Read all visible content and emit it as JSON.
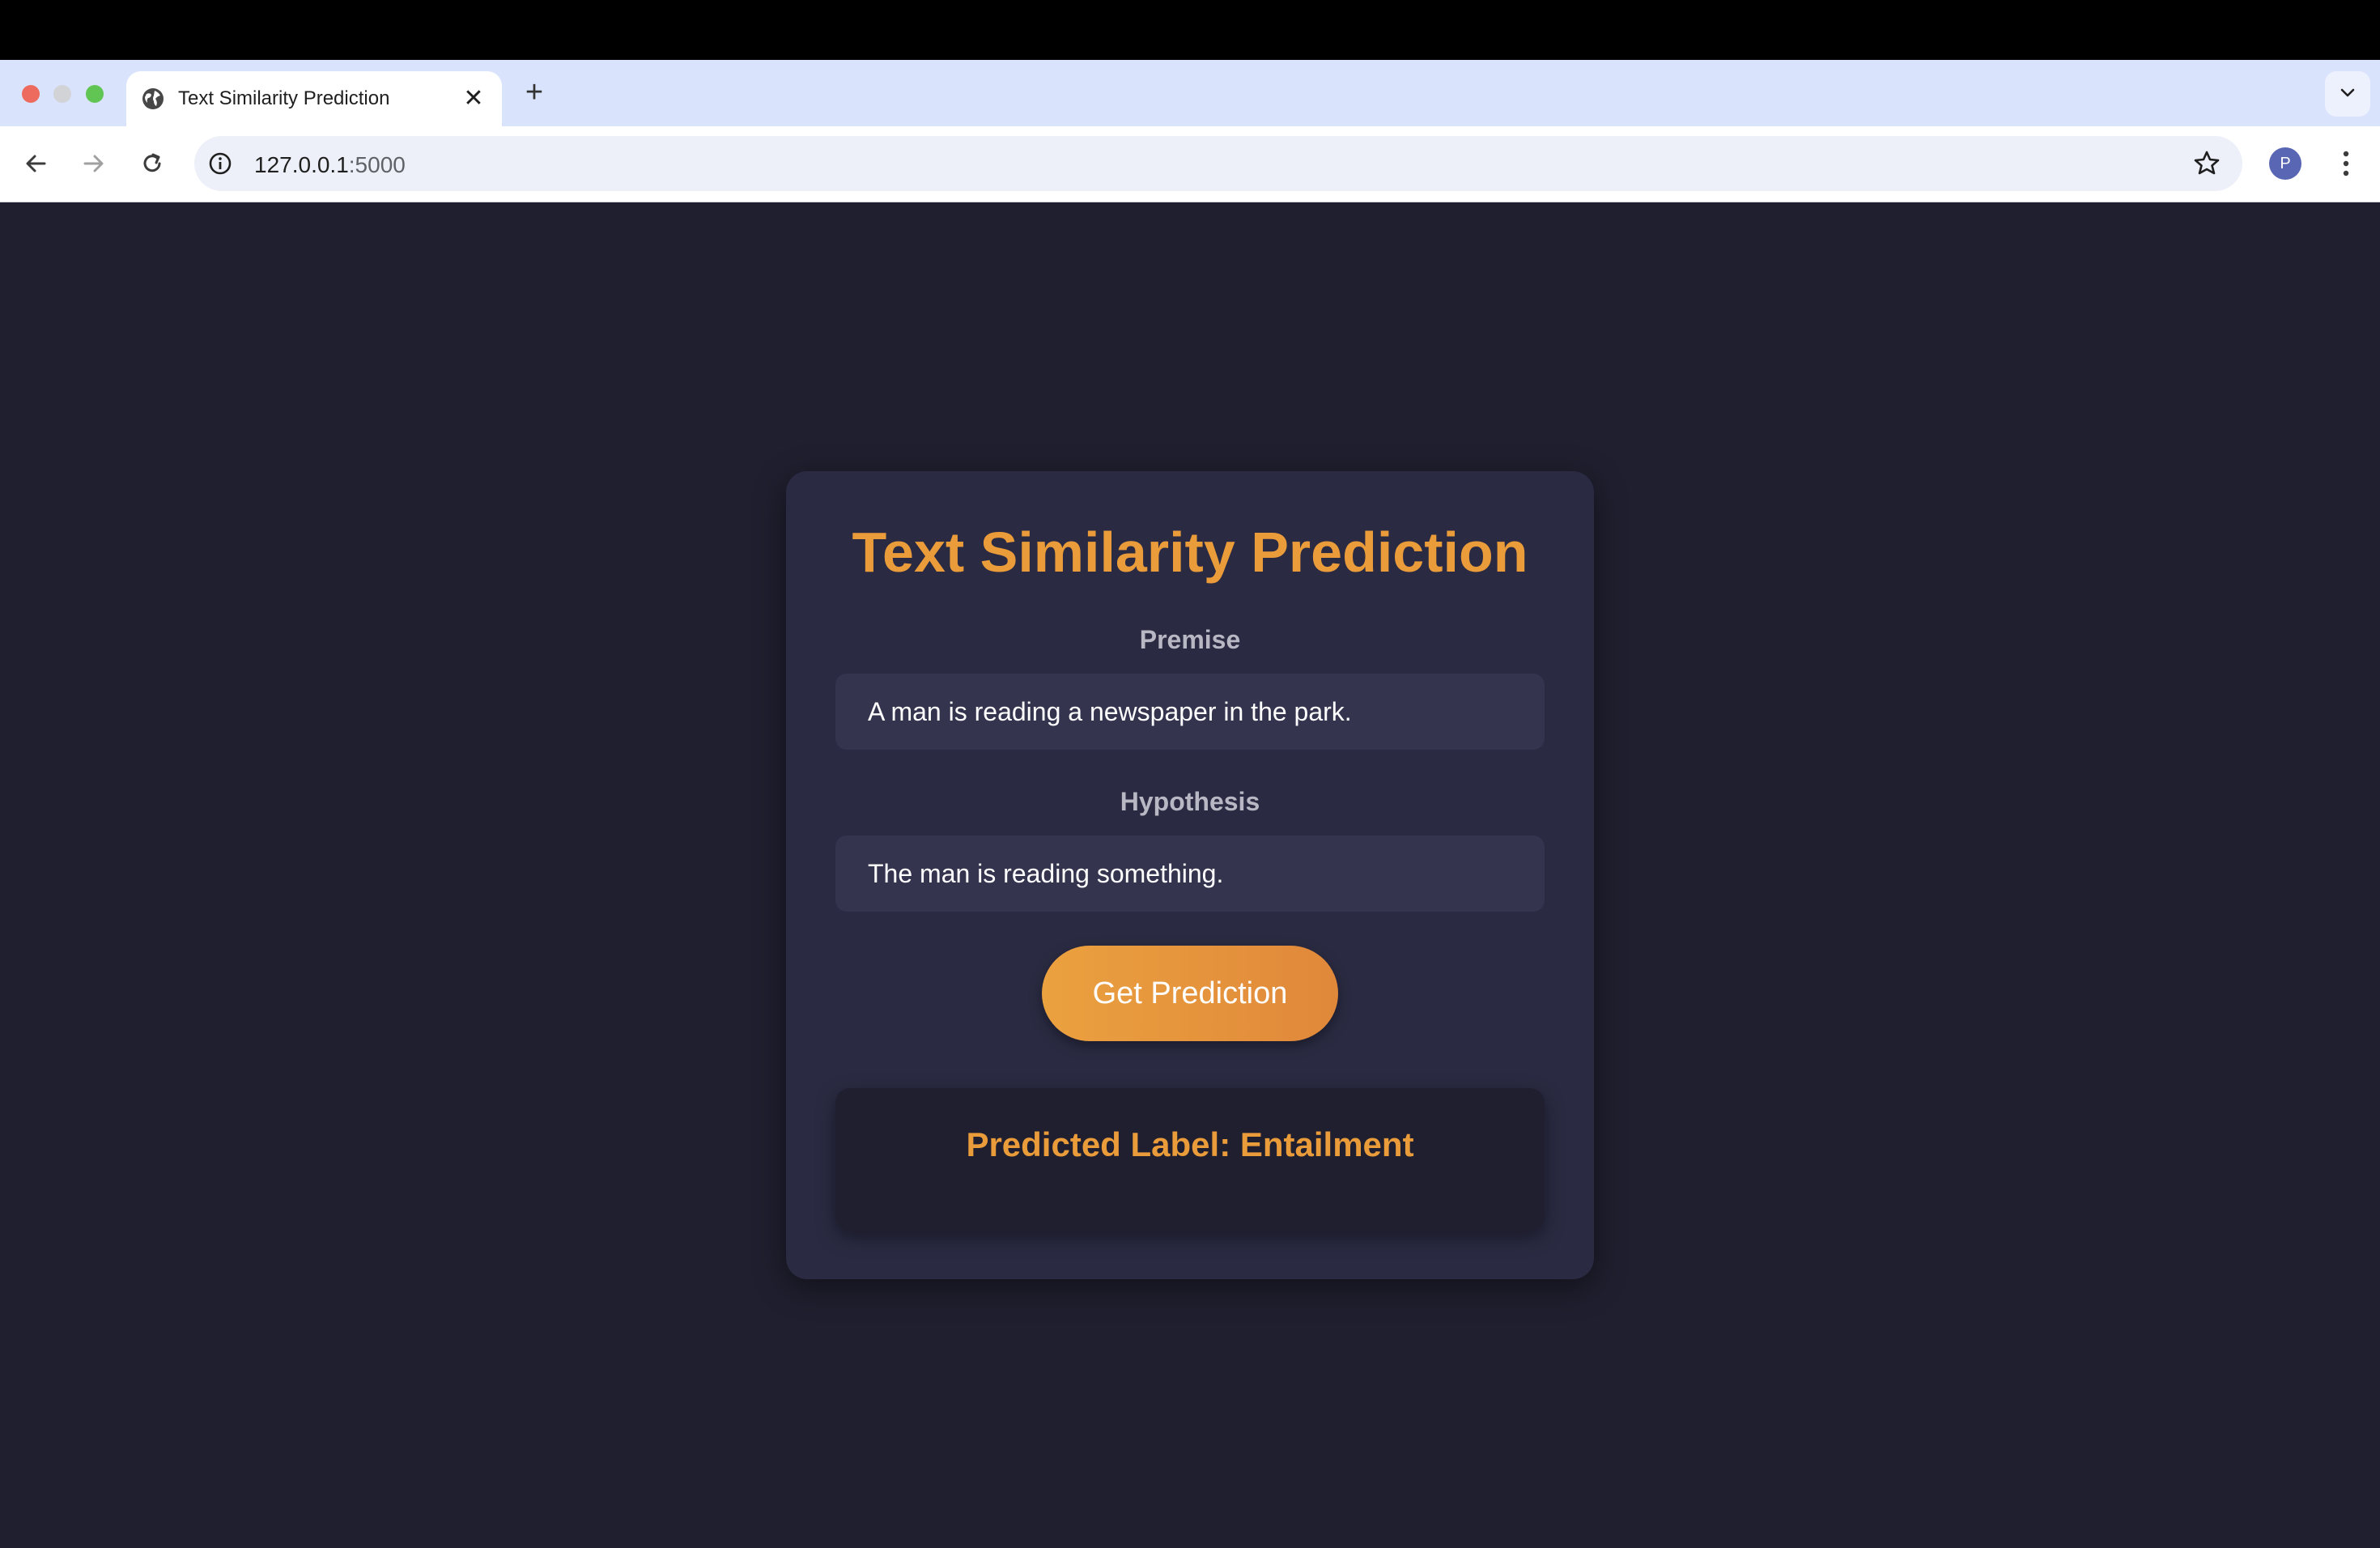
{
  "browser": {
    "tab_title": "Text Similarity Prediction",
    "new_tab_symbol": "+",
    "close_symbol": "✕",
    "url_host": "127.0.0.1",
    "url_port": ":5000",
    "avatar_letter": "P"
  },
  "page": {
    "title": "Text Similarity Prediction",
    "premise_label": "Premise",
    "premise_value": "A man is reading a newspaper in the park.",
    "hypothesis_label": "Hypothesis",
    "hypothesis_value": "The man is reading something.",
    "button_label": "Get Prediction",
    "result_text": "Predicted Label: Entailment"
  },
  "colors": {
    "accent": "#eb9c3a",
    "page_background": "#1f1f2f",
    "card_background": "#2a2a42",
    "input_background": "#34344f"
  },
  "icons": [
    "globe-icon",
    "close-icon",
    "plus-icon",
    "chevron-down-icon",
    "back-arrow-icon",
    "forward-arrow-icon",
    "reload-icon",
    "info-icon",
    "star-icon",
    "more-vert-icon"
  ]
}
